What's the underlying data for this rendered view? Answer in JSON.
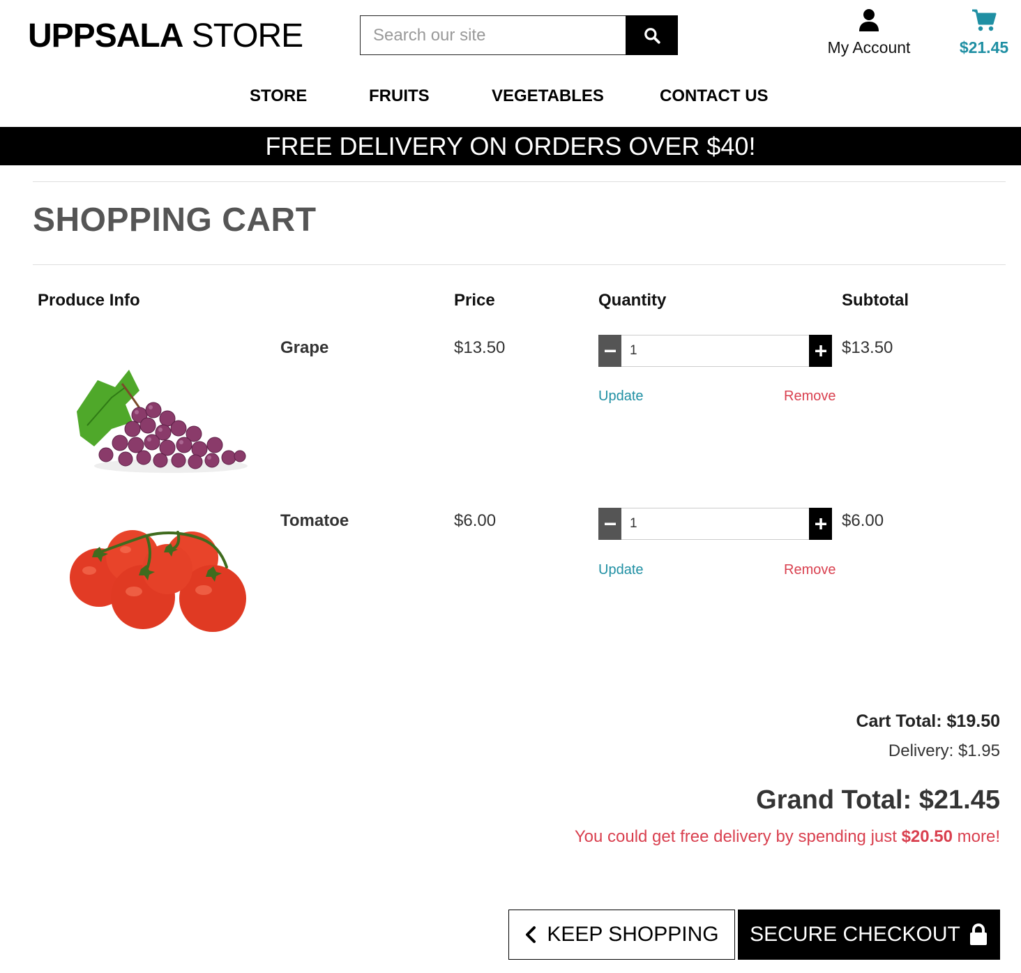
{
  "header": {
    "logo_bold": "UPPSALA",
    "logo_light": " STORE",
    "search_placeholder": "Search our site",
    "account_label": "My Account",
    "cart_total": "$21.45"
  },
  "nav": [
    "STORE",
    "FRUITS",
    "VEGETABLES",
    "CONTACT US"
  ],
  "banner": "FREE DELIVERY ON ORDERS OVER $40!",
  "page_title": "SHOPPING CART",
  "table_headers": {
    "produce": "Produce Info",
    "price": "Price",
    "quantity": "Quantity",
    "subtotal": "Subtotal"
  },
  "items": [
    {
      "name": "Grape",
      "price": "$13.50",
      "qty": "1",
      "subtotal": "$13.50",
      "update": "Update",
      "remove": "Remove"
    },
    {
      "name": "Tomatoe",
      "price": "$6.00",
      "qty": "1",
      "subtotal": "$6.00",
      "update": "Update",
      "remove": "Remove"
    }
  ],
  "summary": {
    "cart_total_label": "Cart Total: ",
    "cart_total_value": "$19.50",
    "delivery_label": "Delivery: ",
    "delivery_value": "$1.95",
    "grand_total_label": "Grand Total: ",
    "grand_total_value": "$21.45",
    "free_delivery_prefix": "You could get free delivery by spending just ",
    "free_delivery_amount": "$20.50",
    "free_delivery_suffix": " more!"
  },
  "buttons": {
    "keep_shopping": "KEEP SHOPPING",
    "secure_checkout": "SECURE CHECKOUT"
  },
  "colors": {
    "accent": "#1f8fa3",
    "danger": "#d9404f",
    "black": "#000000"
  }
}
